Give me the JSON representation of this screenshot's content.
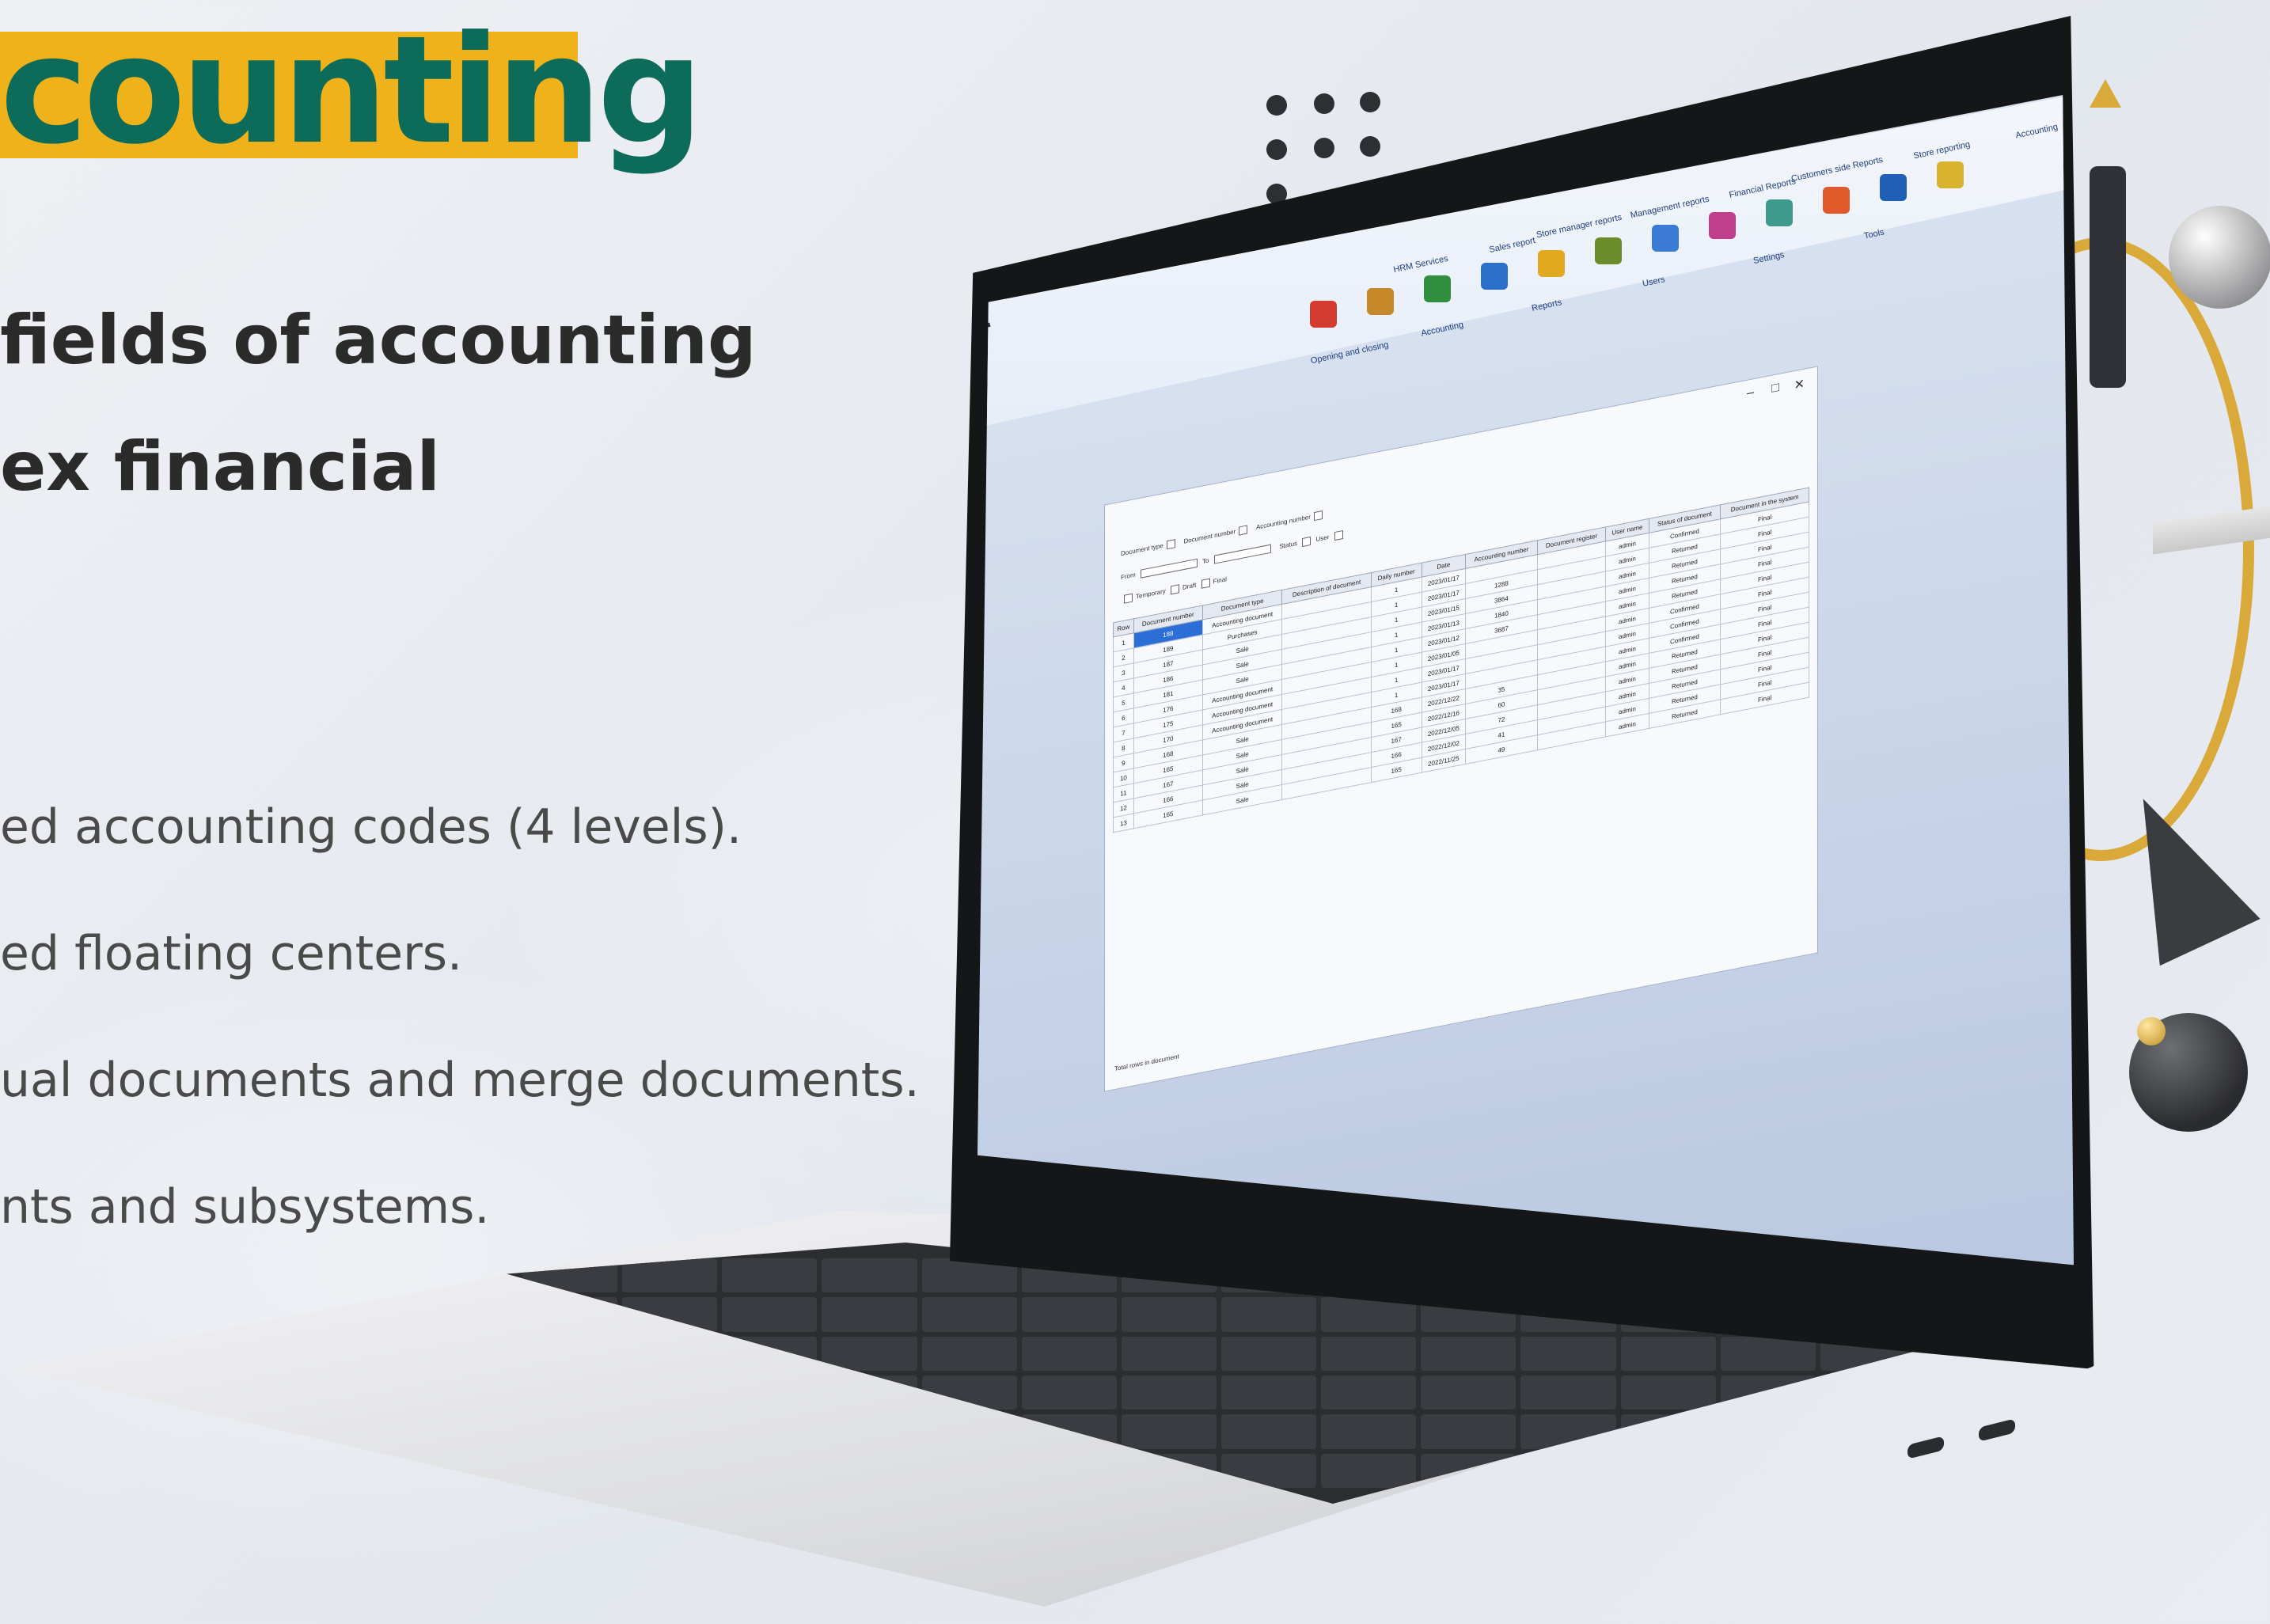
{
  "headline": {
    "title": "counting",
    "subtitle_lines": [
      "fields of accounting",
      "ex financial"
    ]
  },
  "features": [
    "ed accounting codes (4 levels).",
    "ed floating centers.",
    "ual documents and merge documents.",
    "nts and subsystems."
  ],
  "colors": {
    "title_highlight": "#f0b21b",
    "title_text": "#0d6b59",
    "gold_ring": "#d9a93a"
  },
  "app": {
    "menu": [
      "Accounting",
      "Store reporting",
      "Customers side Reports",
      "Financial Reports",
      "Management reports",
      "Store manager reports",
      "Sales report",
      "HRM Services"
    ],
    "ribbon_groups": [
      "Opening and closing",
      "Accounting",
      "Reports",
      "Users",
      "Settings",
      "Tools"
    ],
    "table_columns": [
      "Row",
      "Document number",
      "Document type",
      "Description of document",
      "Daily number",
      "Date",
      "Accounting number",
      "Document register",
      "User name",
      "Status of document",
      "Document in the system"
    ],
    "rows": [
      {
        "row": "1",
        "num": "188",
        "type": "Accounting document",
        "date": "2023/01/17",
        "daily": "1",
        "acc": "",
        "user": "admin",
        "status": "Confirmed",
        "sys": "Final"
      },
      {
        "row": "2",
        "num": "189",
        "type": "Purchases",
        "date": "2023/01/17",
        "daily": "1",
        "acc": "1288",
        "user": "admin",
        "status": "Returned",
        "sys": "Final"
      },
      {
        "row": "3",
        "num": "187",
        "type": "Sale",
        "date": "2023/01/15",
        "daily": "1",
        "acc": "3864",
        "user": "admin",
        "status": "Returned",
        "sys": "Final"
      },
      {
        "row": "4",
        "num": "186",
        "type": "Sale",
        "date": "2023/01/13",
        "daily": "1",
        "acc": "1840",
        "user": "admin",
        "status": "Returned",
        "sys": "Final"
      },
      {
        "row": "5",
        "num": "181",
        "type": "Sale",
        "date": "2023/01/12",
        "daily": "1",
        "acc": "3687",
        "user": "admin",
        "status": "Returned",
        "sys": "Final"
      },
      {
        "row": "6",
        "num": "176",
        "type": "Accounting document",
        "date": "2023/01/05",
        "daily": "1",
        "acc": "",
        "user": "admin",
        "status": "Confirmed",
        "sys": "Final"
      },
      {
        "row": "7",
        "num": "175",
        "type": "Accounting document",
        "date": "2023/01/17",
        "daily": "1",
        "acc": "",
        "user": "admin",
        "status": "Confirmed",
        "sys": "Final"
      },
      {
        "row": "8",
        "num": "170",
        "type": "Accounting document",
        "date": "2023/01/17",
        "daily": "1",
        "acc": "",
        "user": "admin",
        "status": "Confirmed",
        "sys": "Final"
      },
      {
        "row": "9",
        "num": "168",
        "type": "Sale",
        "date": "2022/12/22",
        "daily": "168",
        "acc": "35",
        "user": "admin",
        "status": "Returned",
        "sys": "Final"
      },
      {
        "row": "10",
        "num": "165",
        "type": "Sale",
        "date": "2022/12/16",
        "daily": "165",
        "acc": "60",
        "user": "admin",
        "status": "Returned",
        "sys": "Final"
      },
      {
        "row": "11",
        "num": "167",
        "type": "Sale",
        "date": "2022/12/05",
        "daily": "167",
        "acc": "72",
        "user": "admin",
        "status": "Returned",
        "sys": "Final"
      },
      {
        "row": "12",
        "num": "166",
        "type": "Sale",
        "date": "2022/12/02",
        "daily": "166",
        "acc": "41",
        "user": "admin",
        "status": "Returned",
        "sys": "Final"
      },
      {
        "row": "13",
        "num": "165",
        "type": "Sale",
        "date": "2022/11/25",
        "daily": "165",
        "acc": "49",
        "user": "admin",
        "status": "Returned",
        "sys": "Final"
      }
    ],
    "window_labels": {
      "doc_type": "Document type",
      "doc_number": "Document number",
      "accounting_number": "Accounting number",
      "from": "From",
      "to": "To",
      "status": "Status",
      "user": "User",
      "temporary": "Temporary",
      "draft": "Draft",
      "final": "Final"
    },
    "status_text": "Total rows in document"
  }
}
